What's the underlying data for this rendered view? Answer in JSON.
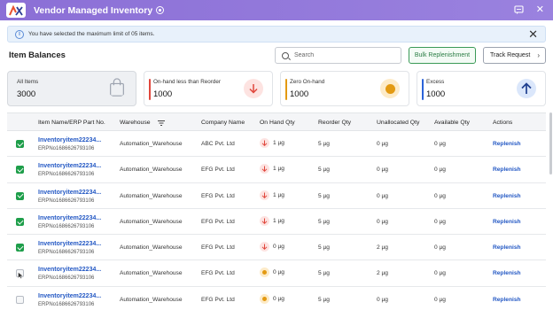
{
  "app": {
    "title": "Vendor Managed Inventory",
    "logo_text": "VMI"
  },
  "info": {
    "text": "You have selected the maximum limit of 05 items."
  },
  "toolbar": {
    "section_title": "Item Balances",
    "search_placeholder": "Search",
    "bulk_label": "Bulk Replenishment",
    "track_label": "Track Request"
  },
  "cards": [
    {
      "label": "All Items",
      "value": "3000",
      "icon": "shopping-bag-icon",
      "accent": "#9ca3af"
    },
    {
      "label": "On-hand less than Reorder",
      "value": "1000",
      "icon": "arrow-down-icon",
      "accent": "#e0463c"
    },
    {
      "label": "Zero On-hand",
      "value": "1000",
      "icon": "dot-icon",
      "accent": "#e39a12"
    },
    {
      "label": "Excess",
      "value": "1000",
      "icon": "arrow-up-icon",
      "accent": "#2b63d9"
    }
  ],
  "table": {
    "columns": [
      "Item Name/ERP Part No.",
      "Warehouse",
      "Company Name",
      "On Hand Qty",
      "Reorder Qty",
      "Unallocated Qty",
      "Available Qty",
      "Actions"
    ],
    "rows": [
      {
        "name": "Inventoryitem22234...",
        "erp": "ERPNo1686626793106",
        "warehouse": "Automation_Warehouse",
        "company": "ABC Pvt. Ltd",
        "onhand": "1 µg",
        "status": "down",
        "reorder": "5 µg",
        "unallocated": "0 µg",
        "available": "0 µg",
        "action": "Replenish",
        "checked": true
      },
      {
        "name": "Inventoryitem22234...",
        "erp": "ERPNo1686626793106",
        "warehouse": "Automation_Warehouse",
        "company": "EFG Pvt. Ltd",
        "onhand": "1 µg",
        "status": "down",
        "reorder": "5 µg",
        "unallocated": "0 µg",
        "available": "0 µg",
        "action": "Replenish",
        "checked": true
      },
      {
        "name": "Inventoryitem22234...",
        "erp": "ERPNo1686626793106",
        "warehouse": "Automation_Warehouse",
        "company": "EFG Pvt. Ltd",
        "onhand": "1 µg",
        "status": "down",
        "reorder": "5 µg",
        "unallocated": "0 µg",
        "available": "0 µg",
        "action": "Replenish",
        "checked": true
      },
      {
        "name": "Inventoryitem22234...",
        "erp": "ERPNo1686626793106",
        "warehouse": "Automation_Warehouse",
        "company": "EFG Pvt. Ltd",
        "onhand": "1 µg",
        "status": "down",
        "reorder": "5 µg",
        "unallocated": "0 µg",
        "available": "0 µg",
        "action": "Replenish",
        "checked": true
      },
      {
        "name": "Inventoryitem22234...",
        "erp": "ERPNo1686626793106",
        "warehouse": "Automation_Warehouse",
        "company": "EFG Pvt. Ltd",
        "onhand": "0 µg",
        "status": "down",
        "reorder": "5 µg",
        "unallocated": "2 µg",
        "available": "0 µg",
        "action": "Replenish",
        "checked": true
      },
      {
        "name": "Inventoryitem22234...",
        "erp": "ERPNo1686626793106",
        "warehouse": "Automation_Warehouse",
        "company": "EFG Pvt. Ltd",
        "onhand": "0 µg",
        "status": "zero",
        "reorder": "5 µg",
        "unallocated": "2 µg",
        "available": "0 µg",
        "action": "Replenish",
        "checked": false
      },
      {
        "name": "Inventoryitem22234...",
        "erp": "ERPNo1686626793106",
        "warehouse": "Automation_Warehouse",
        "company": "EFG Pvt. Ltd",
        "onhand": "0 µg",
        "status": "zero",
        "reorder": "5 µg",
        "unallocated": "0 µg",
        "available": "0 µg",
        "action": "Replenish",
        "checked": false
      }
    ]
  }
}
